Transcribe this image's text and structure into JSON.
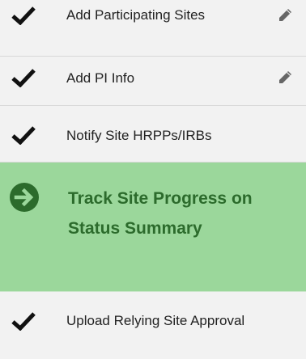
{
  "steps": {
    "add_sites": {
      "label": "Add Participating Sites",
      "state": "complete",
      "editable": true
    },
    "add_pi": {
      "label": "Add PI Info",
      "state": "complete",
      "editable": true
    },
    "notify": {
      "label": "Notify Site HRPPs/IRBs",
      "state": "complete",
      "editable": false
    },
    "track": {
      "label": "Track Site Progress on Status Summary",
      "state": "current",
      "editable": false
    },
    "upload": {
      "label": "Upload Relying Site Approval",
      "state": "complete",
      "editable": false
    }
  },
  "icons": {
    "complete": "check-icon",
    "current": "arrow-circle-right-icon",
    "edit": "pencil-icon"
  },
  "colors": {
    "current_bg": "#9bd79b",
    "current_text": "#2c6b2c",
    "background": "#f2f2f2",
    "check": "#111111",
    "pencil": "#666666"
  }
}
